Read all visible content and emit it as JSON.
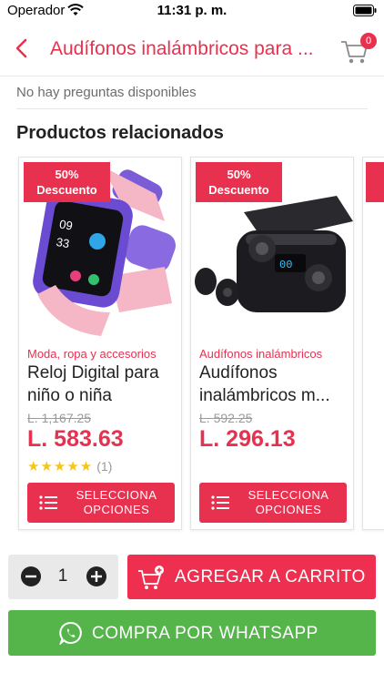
{
  "status_bar": {
    "carrier": "Operador",
    "time": "11:31 p. m."
  },
  "header": {
    "title": "Audífonos inalámbricos para ...",
    "cart_count": "0"
  },
  "questions": {
    "empty_text": "No hay preguntas disponibles"
  },
  "related": {
    "title": "Productos relacionados",
    "products": [
      {
        "badge_line1": "50%",
        "badge_line2": "Descuento",
        "category": "Moda, ropa y accesorios",
        "name": "Reloj Digital para niño o niña",
        "old_price": "L. 1,167.25",
        "price": "L. 583.63",
        "stars": "★★★★★",
        "rating_count": "(1)",
        "button_line1": "SELECCIONA",
        "button_line2": "OPCIONES"
      },
      {
        "badge_line1": "50%",
        "badge_line2": "Descuento",
        "category": "Audífonos inalámbricos",
        "name": "Audífonos inalámbricos m...",
        "old_price": "L. 592.25",
        "price": "L. 296.13",
        "button_line1": "SELECCIONA",
        "button_line2": "OPCIONES"
      }
    ]
  },
  "purchase": {
    "quantity": "1",
    "add_to_cart_label": "AGREGAR A CARRITO",
    "whatsapp_label": "COMPRA POR WHATSAPP"
  },
  "colors": {
    "accent": "#e8304f",
    "whatsapp": "#55b54a",
    "star": "#f5c518"
  },
  "icons": [
    "wifi-icon",
    "battery-icon",
    "back-arrow-icon",
    "cart-icon",
    "list-icon",
    "minus-icon",
    "plus-icon",
    "add-to-cart-icon",
    "whatsapp-icon"
  ]
}
